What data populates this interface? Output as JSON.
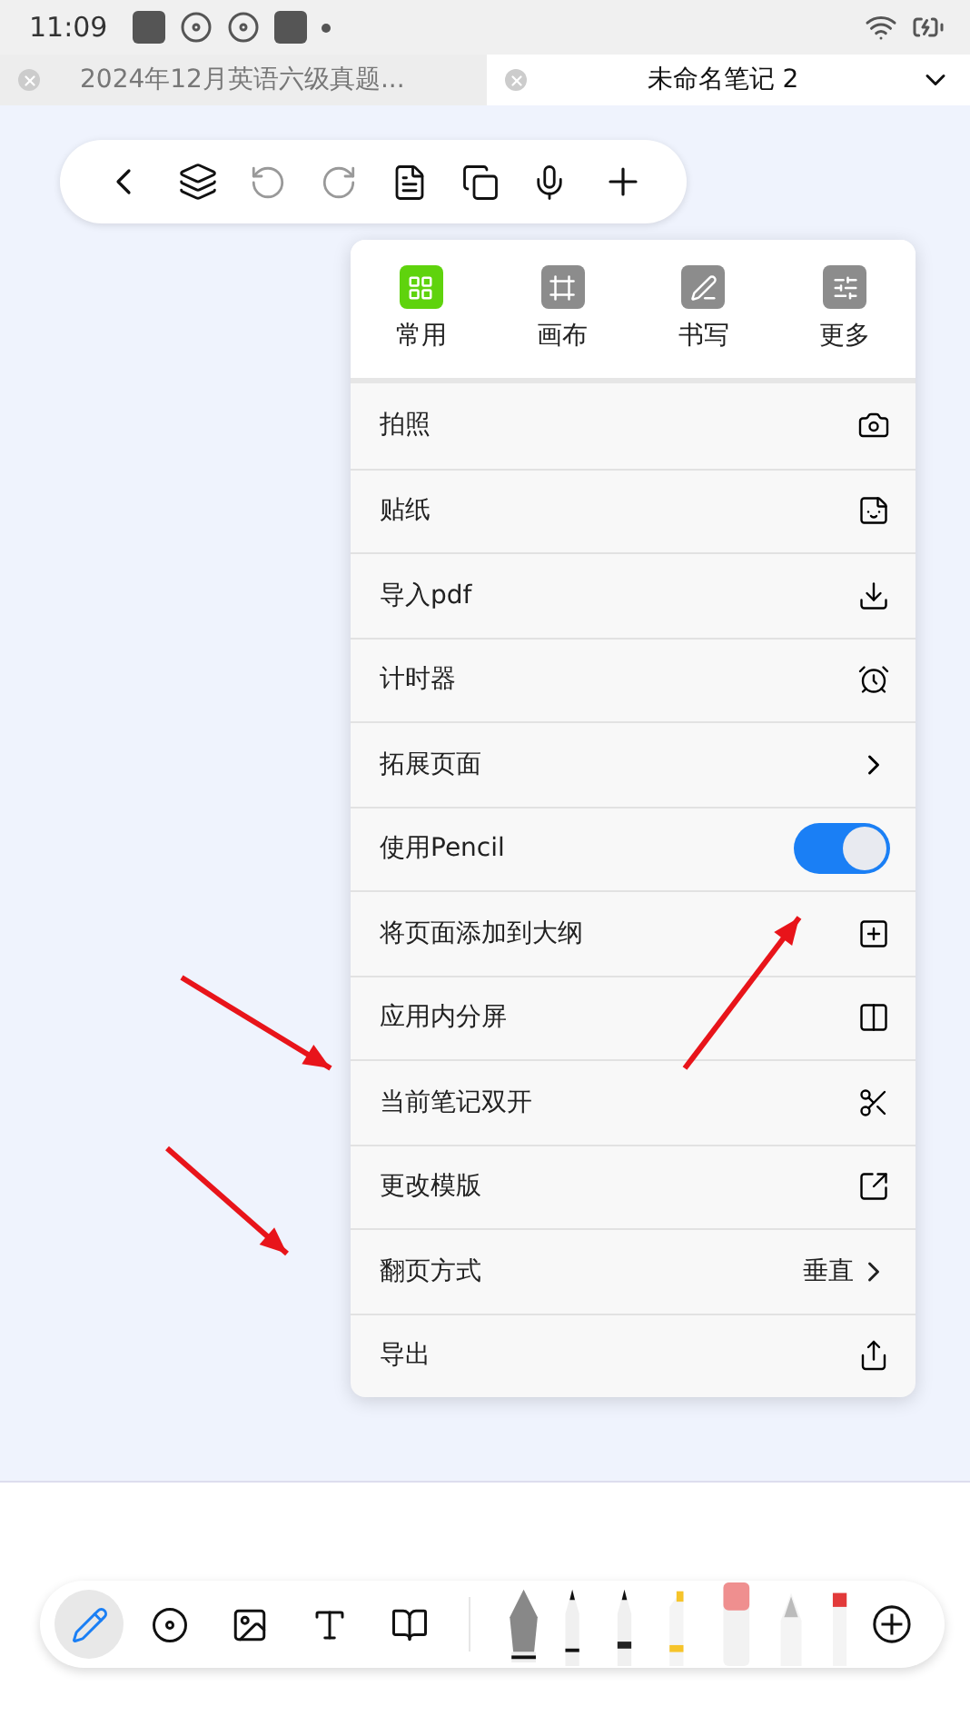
{
  "status_bar": {
    "time": "11:09"
  },
  "tabs": [
    {
      "label": "2024年12月英语六级真题...",
      "selected": false
    },
    {
      "label": "未命名笔记 2",
      "selected": true
    }
  ],
  "menu": {
    "categories": [
      {
        "label": "常用",
        "selected": true
      },
      {
        "label": "画布",
        "selected": false
      },
      {
        "label": "书写",
        "selected": false
      },
      {
        "label": "更多",
        "selected": false
      }
    ],
    "rows": [
      {
        "label": "拍照",
        "kind": "icon"
      },
      {
        "label": "贴纸",
        "kind": "icon"
      },
      {
        "label": "导入pdf",
        "kind": "icon"
      },
      {
        "label": "计时器",
        "kind": "icon"
      },
      {
        "label": "拓展页面",
        "kind": "chevron"
      },
      {
        "label": "使用Pencil",
        "kind": "toggle",
        "on": true
      },
      {
        "label": "将页面添加到大纲",
        "kind": "icon"
      },
      {
        "label": "应用内分屏",
        "kind": "icon"
      },
      {
        "label": "当前笔记双开",
        "kind": "icon"
      },
      {
        "label": "更改模版",
        "kind": "icon"
      },
      {
        "label": "翻页方式",
        "kind": "value",
        "value": "垂直"
      },
      {
        "label": "导出",
        "kind": "icon"
      }
    ]
  },
  "bottom_toolbar": {
    "tools": [
      {
        "selected": true
      },
      {
        "selected": false
      },
      {
        "selected": false
      },
      {
        "selected": false
      },
      {
        "selected": false
      }
    ]
  }
}
